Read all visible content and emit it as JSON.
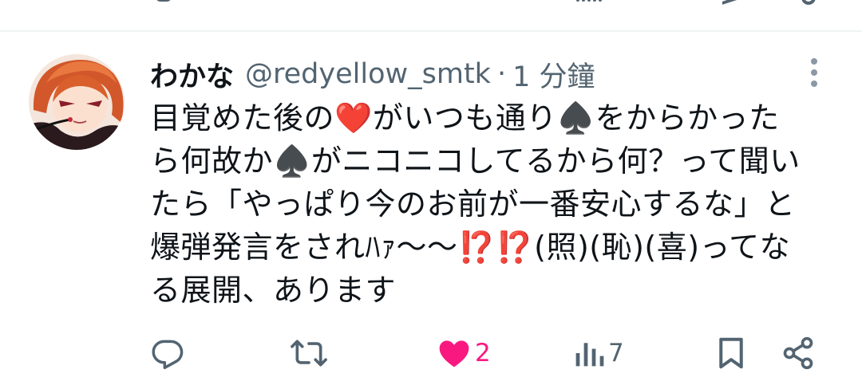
{
  "tweet": {
    "author_name": "わかな",
    "author_handle": "@redyellow_smtk",
    "separator": "·",
    "time": "1 分鐘",
    "text_lines": [
      "目覚めた後の❤️がいつも通り♠️をからかった",
      "ら何故か♠️がニコニコしてるから何？って聞い",
      "たら「やっぱり今のお前が一番安心するな」と",
      "爆弾発言をされﾊｧ～～⁉️⁉️(照)(恥)(喜)ってな",
      "る展開、あります"
    ]
  },
  "actions": {
    "reply_icon": "reply-icon",
    "retweet_icon": "retweet-icon",
    "like_icon": "heart-filled-icon",
    "like_count": "2",
    "views_icon": "bar-chart-icon",
    "views_count": "7",
    "bookmark_icon": "bookmark-icon",
    "share_icon": "share-icon"
  },
  "colors": {
    "text": "#0f1419",
    "secondary": "#536471",
    "like": "#f91880",
    "divider": "#eff3f4"
  }
}
